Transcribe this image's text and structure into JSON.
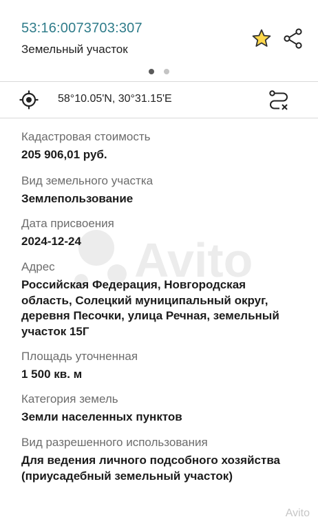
{
  "header": {
    "cadastral_number": "53:16:0073703:307",
    "object_type": "Земельный участок",
    "icons": {
      "favorite": "star-icon",
      "share": "share-icon"
    },
    "pager": {
      "pages": 2,
      "active": 1
    }
  },
  "coords_bar": {
    "coordinates": "58°10.05'N, 30°31.15'E",
    "icons": {
      "locate": "gps-target-icon",
      "route": "route-icon"
    }
  },
  "fields": [
    {
      "label": "Кадастровая стоимость",
      "value": "205 906,01 руб."
    },
    {
      "label": "Вид земельного участка",
      "value": "Землепользование"
    },
    {
      "label": "Дата присвоения",
      "value": "2024-12-24"
    },
    {
      "label": "Адрес",
      "value": "Российская Федерация, Новгородская область, Солецкий муниципальный округ, деревня Песочки, улица Речная, земельный участок 15Г"
    },
    {
      "label": "Площадь уточненная",
      "value": "1 500 кв. м"
    },
    {
      "label": "Категория земель",
      "value": "Земли населенных пунктов"
    },
    {
      "label": "Вид разрешенного использования",
      "value": "Для ведения личного подсобного хозяйства (приусадебный земельный участок)"
    }
  ],
  "watermark": {
    "text": "Avito"
  },
  "colors": {
    "accent": "#2f7c8a",
    "star": "#e6b800",
    "label": "#6c6c6c"
  }
}
